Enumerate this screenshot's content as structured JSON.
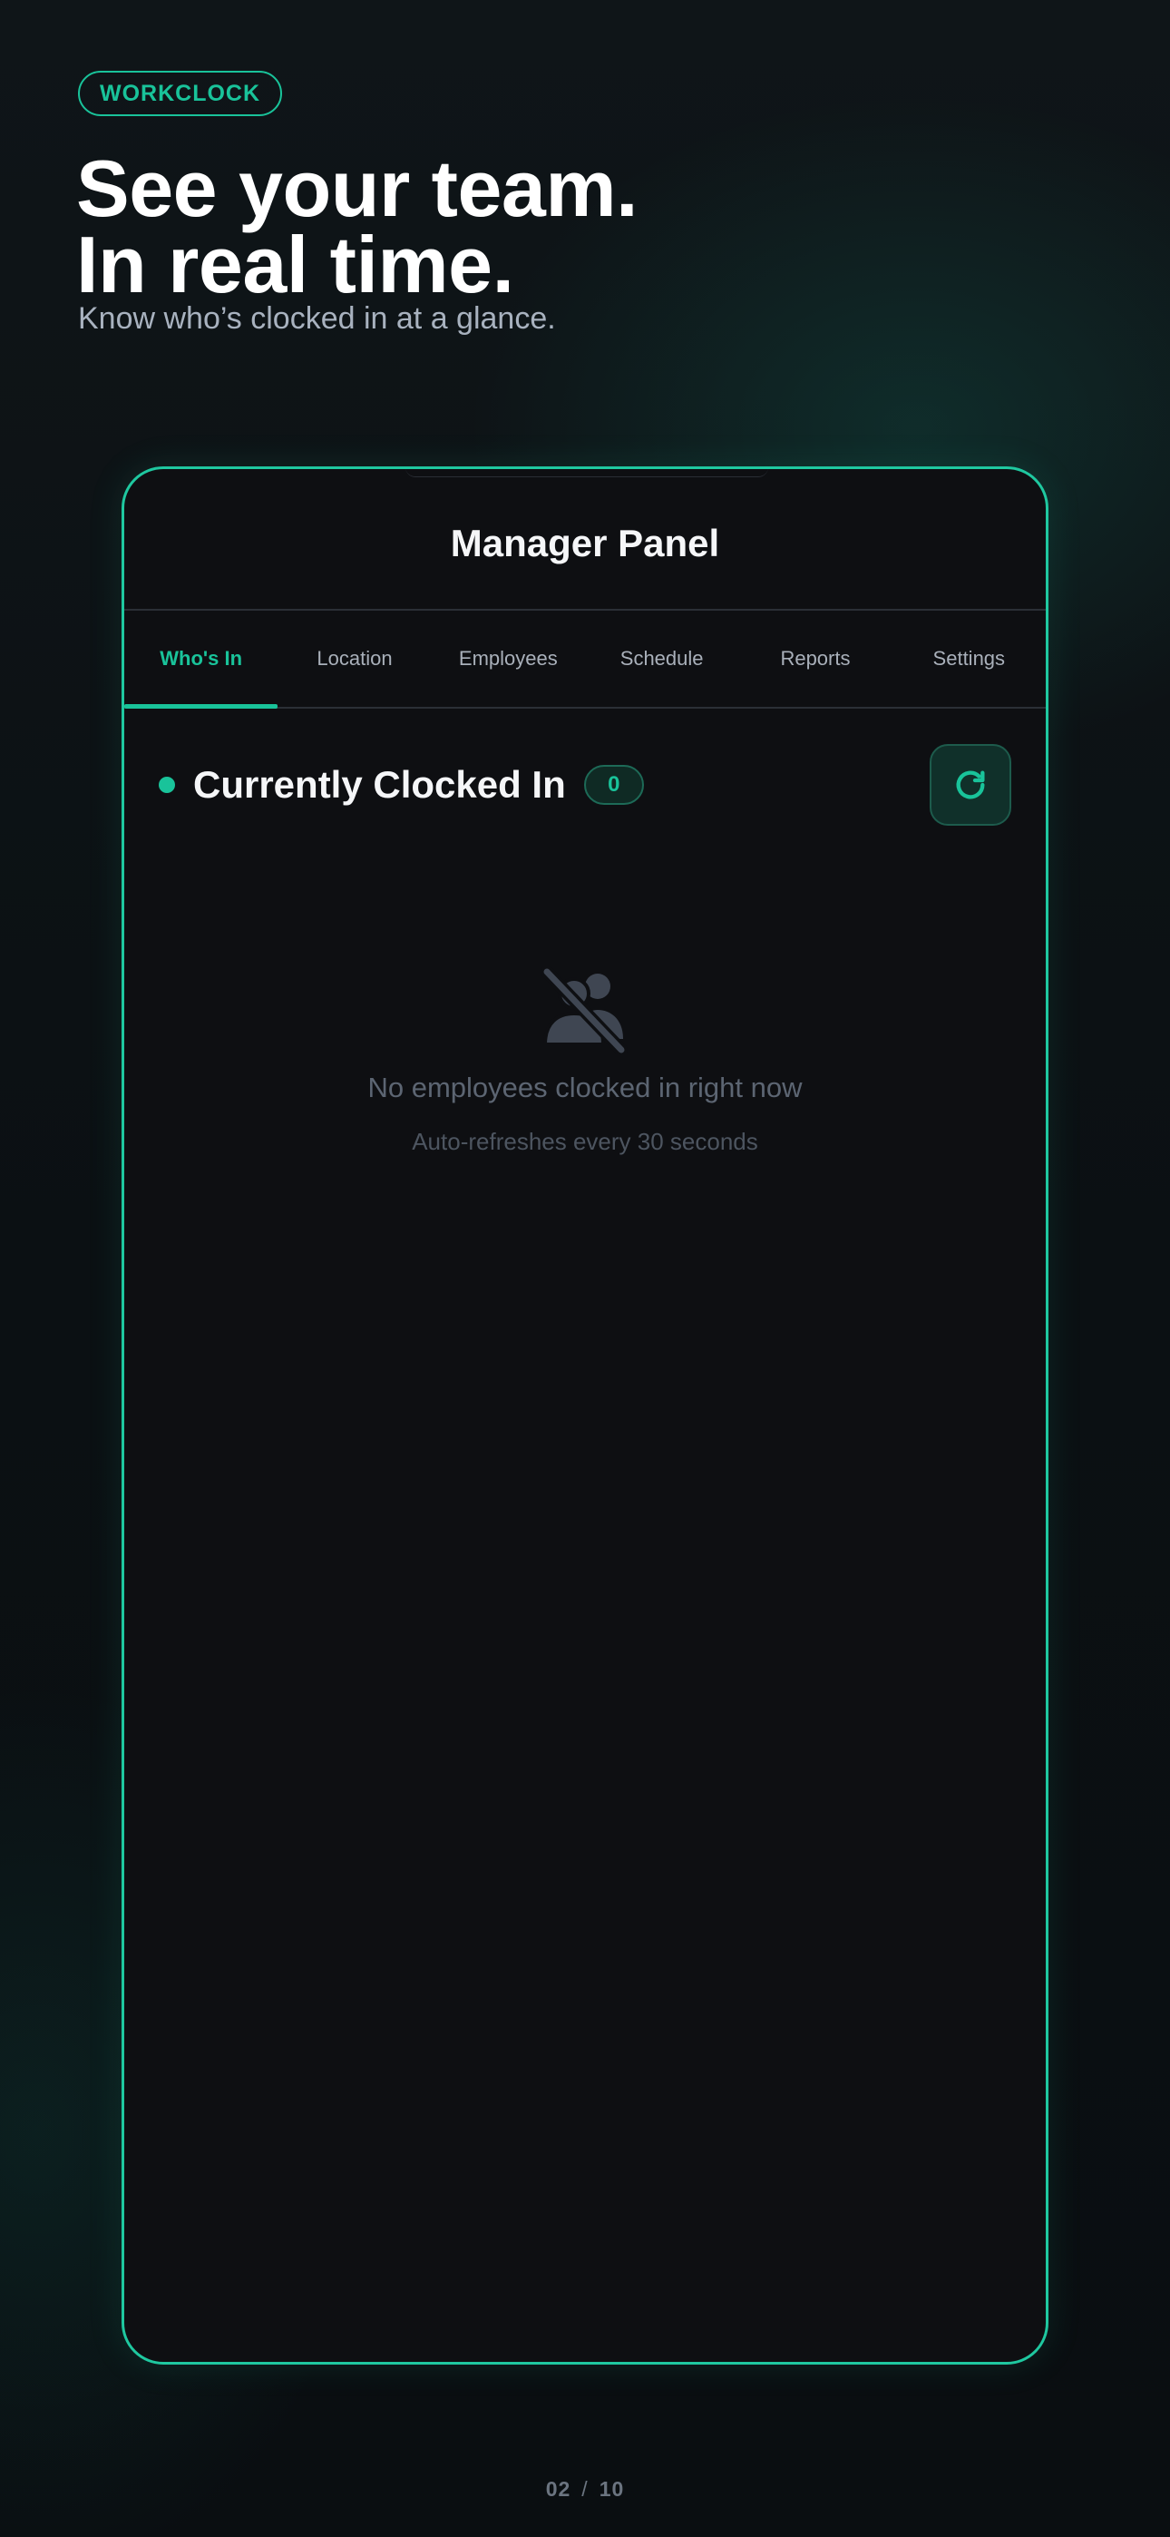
{
  "brand": {
    "label": "WORKCLOCK"
  },
  "hero": {
    "headline_line1": "See your team.",
    "headline_line2": "In real time.",
    "subtitle": "Know who’s clocked in at a glance."
  },
  "app": {
    "title": "Manager Panel",
    "tabs": [
      {
        "label": "Who's In",
        "active": true
      },
      {
        "label": "Location",
        "active": false
      },
      {
        "label": "Employees",
        "active": false
      },
      {
        "label": "Schedule",
        "active": false
      },
      {
        "label": "Reports",
        "active": false
      },
      {
        "label": "Settings",
        "active": false
      }
    ],
    "section": {
      "title": "Currently Clocked In",
      "count": "0",
      "refresh_icon": "refresh-icon"
    },
    "empty_state": {
      "icon": "users-slash-icon",
      "title": "No employees clocked in right now",
      "subtitle": "Auto-refreshes every 30 seconds"
    }
  },
  "pager": {
    "current": "02",
    "separator": "/",
    "total": "10"
  },
  "colors": {
    "accent": "#19c39a",
    "frame_border": "#1fc8a0",
    "background": "#0b1013",
    "panel": "#0e0f12",
    "muted_text": "#5c6572"
  }
}
